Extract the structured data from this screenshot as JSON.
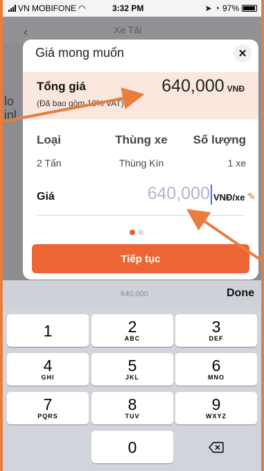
{
  "status_bar": {
    "carrier": "VN MOBIFONE",
    "time": "3:32 PM",
    "battery": "97%"
  },
  "background_app": {
    "title": "Xe Tải",
    "side_text": "lo\ninl"
  },
  "modal": {
    "title": "Giá mong muốn",
    "total_label": "Tổng giá",
    "total_value": "640,000",
    "total_unit": "VNĐ",
    "vat_note": "(Đã bao gồm 10% VAT)",
    "columns": {
      "headers": [
        "Loại",
        "Thùng xe",
        "Số lượng"
      ],
      "values": [
        "2 Tấn",
        "Thùng Kín",
        "1 xe"
      ]
    },
    "price_label": "Giá",
    "price_input": {
      "value": "640,000",
      "unit": "VNĐ/xe"
    },
    "pager": {
      "total": 2,
      "active": 1
    },
    "continue_label": "Tiếp tục"
  },
  "keyboard": {
    "preview": "640,000",
    "done_label": "Done",
    "keys": [
      {
        "num": "1",
        "letters": ""
      },
      {
        "num": "2",
        "letters": "ABC"
      },
      {
        "num": "3",
        "letters": "DEF"
      },
      {
        "num": "4",
        "letters": "GHI"
      },
      {
        "num": "5",
        "letters": "JKL"
      },
      {
        "num": "6",
        "letters": "MNO"
      },
      {
        "num": "7",
        "letters": "PQRS"
      },
      {
        "num": "8",
        "letters": "TUV"
      },
      {
        "num": "9",
        "letters": "WXYZ"
      },
      {
        "num": "0",
        "letters": ""
      }
    ]
  },
  "colors": {
    "accent": "#ed6535",
    "annotation": "#e87d3e",
    "input_text": "#aeb6cc"
  }
}
